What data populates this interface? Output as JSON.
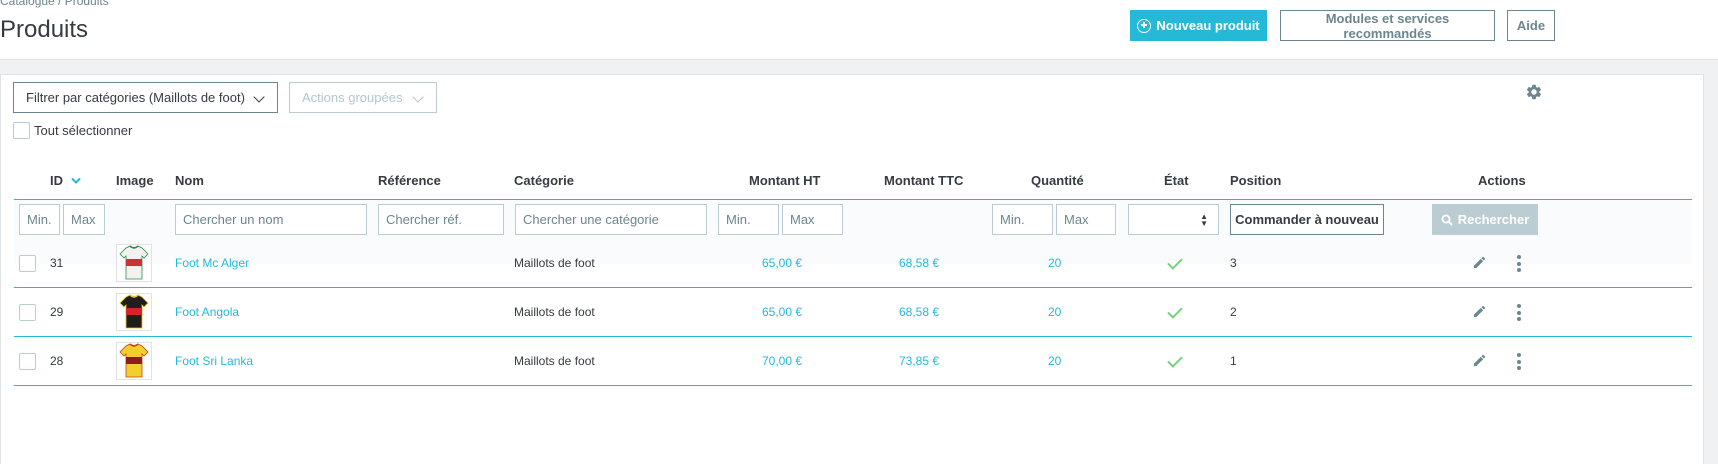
{
  "breadcrumb": "Catalogue / Produits",
  "page_title": "Produits",
  "header_buttons": {
    "new_product": "Nouveau produit",
    "modules": "Modules et services recommandés",
    "help": "Aide"
  },
  "toolbar": {
    "filter_categories": "Filtrer par catégories (Maillots de foot)",
    "bulk_actions": "Actions groupées",
    "select_all": "Tout sélectionner"
  },
  "columns": {
    "id": "ID",
    "image": "Image",
    "name": "Nom",
    "reference": "Référence",
    "category": "Catégorie",
    "price_ht": "Montant HT",
    "price_ttc": "Montant TTC",
    "quantity": "Quantité",
    "status": "État",
    "position": "Position",
    "actions": "Actions"
  },
  "filters": {
    "id_min": "Min.",
    "id_max": "Max",
    "name": "Chercher un nom",
    "reference": "Chercher réf.",
    "category": "Chercher une catégorie",
    "price_min": "Min.",
    "price_max": "Max",
    "qty_min": "Min.",
    "qty_max": "Max",
    "reorder_button": "Commander à nouveau",
    "search_button": "Rechercher"
  },
  "rows": [
    {
      "id": "31",
      "name": "Foot Mc Alger",
      "category": "Maillots de foot",
      "price_ht": "65,00 €",
      "price_ttc": "68,58 €",
      "quantity": "20",
      "status": "active",
      "position": "3",
      "jersey": {
        "main": "#f2f2f2",
        "accent": "#c7352c",
        "trim": "#2d8a4a"
      }
    },
    {
      "id": "29",
      "name": "Foot Angola",
      "category": "Maillots de foot",
      "price_ht": "65,00 €",
      "price_ttc": "68,58 €",
      "quantity": "20",
      "status": "active",
      "position": "2",
      "jersey": {
        "main": "#1e1e1e",
        "accent": "#d8232a",
        "trim": "#f2c31b"
      }
    },
    {
      "id": "28",
      "name": "Foot Sri Lanka",
      "category": "Maillots de foot",
      "price_ht": "70,00 €",
      "price_ttc": "73,85 €",
      "quantity": "20",
      "status": "active",
      "position": "1",
      "jersey": {
        "main": "#f3cf2b",
        "accent": "#8c1d1d",
        "trim": "#c8401f"
      }
    }
  ],
  "colors": {
    "accent": "#25b9d7",
    "success": "#78d07d",
    "text": "#363a41",
    "muted": "#6c868e"
  }
}
